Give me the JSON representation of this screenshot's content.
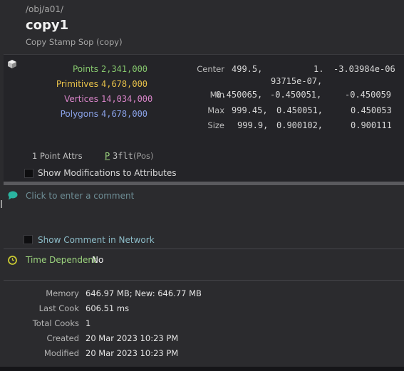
{
  "node": {
    "path": "/obj/a01/",
    "name": "copy1",
    "type": "Copy Stamp Sop (copy)"
  },
  "stats": {
    "points_label": "Points",
    "points_value": "2,341,000",
    "prims_label": "Primitives",
    "prims_value": "4,678,000",
    "verts_label": "Vertices",
    "verts_value": "14,034,000",
    "polys_label": "Polygons",
    "polys_value": "4,678,000"
  },
  "bounds": {
    "center_label": "Center",
    "center_x": "499.5,",
    "center_y": "1.",
    "center_z": "-3.03984e-06",
    "center_cont": "93715e-07,",
    "min_label": "Min",
    "min_x": "-0.450065,",
    "min_y": "-0.450051,",
    "min_z": "-0.450059",
    "max_label": "Max",
    "max_x": "999.45,",
    "max_y": "0.450051,",
    "max_z": "0.450053",
    "size_label": "Size",
    "size_x": "999.9,",
    "size_y": "0.900102,",
    "size_z": "0.900111"
  },
  "attrs": {
    "label": "1 Point Attrs",
    "class": "P",
    "type": "3flt",
    "name": "(Pos)"
  },
  "show_mods_label": "Show Modifications to Attributes",
  "comment": {
    "placeholder": "Click to enter a comment",
    "show_in_network_label": "Show Comment in Network"
  },
  "time": {
    "label": "Time Dependent",
    "value": "No"
  },
  "info": {
    "memory_label": "Memory",
    "memory_value": "646.97 MB; New: 646.77 MB",
    "lastcook_label": "Last Cook",
    "lastcook_value": "606.51 ms",
    "totalcooks_label": "Total Cooks",
    "totalcooks_value": "1",
    "created_label": "Created",
    "created_value": "20 Mar 2023 10:23 PM",
    "modified_label": "Modified",
    "modified_value": "20 Mar 2023 10:23 PM"
  },
  "colors": {
    "points": "#86c86e",
    "primitives": "#e8c24a",
    "vertices": "#d884c8",
    "polygons": "#8aa2e8",
    "comment_icon": "#2ab4a0",
    "time_label": "#9cd47e"
  }
}
